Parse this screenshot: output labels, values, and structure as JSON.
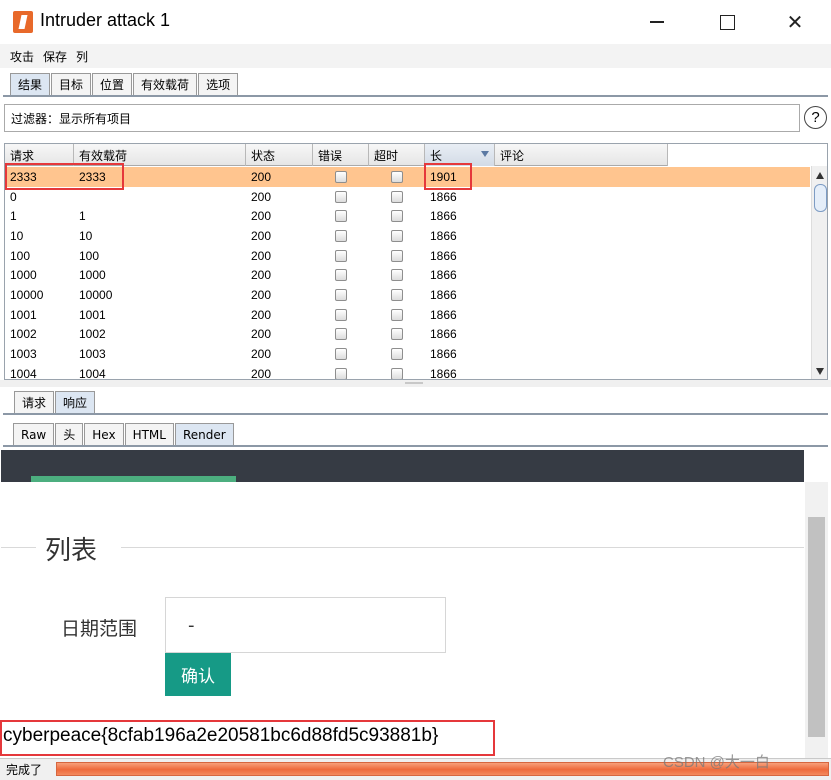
{
  "window": {
    "title": "Intruder attack 1",
    "min_glyph": "",
    "max_glyph": "",
    "close_glyph": "✕"
  },
  "menu": [
    "攻击",
    "保存",
    "列"
  ],
  "top_tabs": [
    "结果",
    "目标",
    "位置",
    "有效载荷",
    "选项"
  ],
  "filter": {
    "label": "过滤器：显示所有项目",
    "help": "?"
  },
  "table": {
    "columns": [
      "请求",
      "有效载荷",
      "状态",
      "错误",
      "超时",
      "长",
      "评论"
    ],
    "sorted_column": "长",
    "rows": [
      {
        "request": "2333",
        "payload": "2333",
        "status": "200",
        "length": "1901",
        "selected": true
      },
      {
        "request": "0",
        "payload": "",
        "status": "200",
        "length": "1866"
      },
      {
        "request": "1",
        "payload": "1",
        "status": "200",
        "length": "1866"
      },
      {
        "request": "10",
        "payload": "10",
        "status": "200",
        "length": "1866"
      },
      {
        "request": "100",
        "payload": "100",
        "status": "200",
        "length": "1866"
      },
      {
        "request": "1000",
        "payload": "1000",
        "status": "200",
        "length": "1866"
      },
      {
        "request": "10000",
        "payload": "10000",
        "status": "200",
        "length": "1866"
      },
      {
        "request": "1001",
        "payload": "1001",
        "status": "200",
        "length": "1866"
      },
      {
        "request": "1002",
        "payload": "1002",
        "status": "200",
        "length": "1866"
      },
      {
        "request": "1003",
        "payload": "1003",
        "status": "200",
        "length": "1866"
      },
      {
        "request": "1004",
        "payload": "1004",
        "status": "200",
        "length": "1866"
      }
    ]
  },
  "req_resp_tabs": [
    "请求",
    "响应"
  ],
  "view_tabs": [
    "Raw",
    "头",
    "Hex",
    "HTML",
    "Render"
  ],
  "render": {
    "legend": "列表",
    "date_label": "日期范围",
    "date_value": "-",
    "confirm": "确认",
    "flag": "cyberpeace{8cfab196a2e20581bc6d88fd5c93881b}"
  },
  "status": {
    "text": "完成了",
    "progress": 1.0
  },
  "watermark": "CSDN @大一白",
  "colors": {
    "selected_row": "#ffc58f",
    "highlight_box": "#e5383b",
    "confirm_button": "#169a86",
    "progress": "#ee6a3c"
  }
}
